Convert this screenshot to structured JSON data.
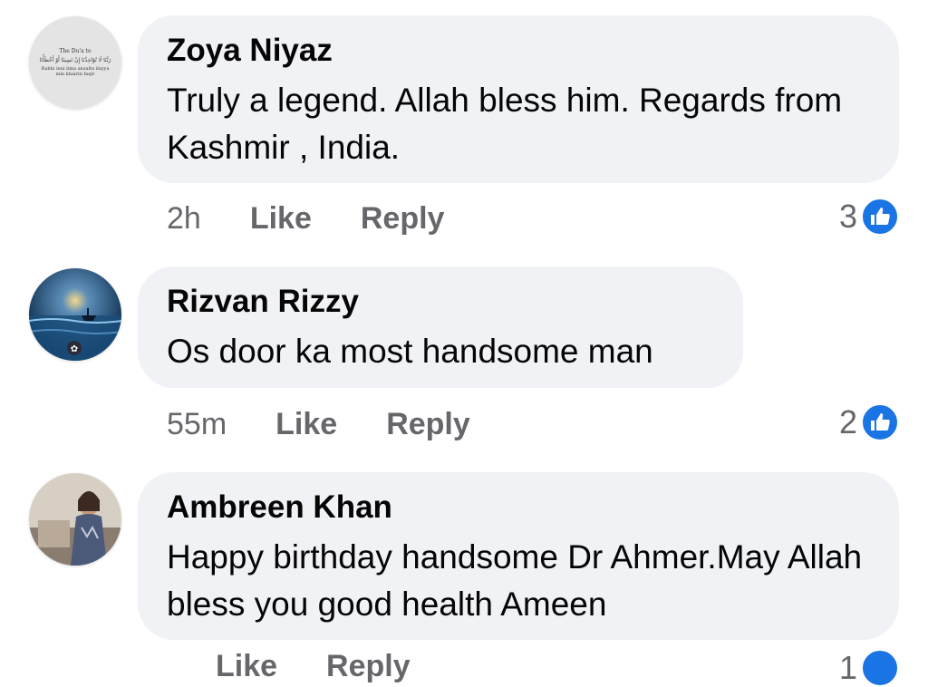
{
  "comments": [
    {
      "author": "Zoya Niyaz",
      "text": "Truly a legend. Allah bless him. Regards from Kashmir , India.",
      "time": "2h",
      "like_label": "Like",
      "reply_label": "Reply",
      "reaction_count": "3",
      "reaction_icon": "thumbs-up-icon",
      "avatar_text": {
        "title": "The Du'a to",
        "arabic": "رَبَّنَا لَا تُؤَاخِذْنَا إِنْ نَسِينَا أَوْ أَخْطَأْنَا",
        "line1": "Rabbi inni lima anzalta ilayya",
        "line2": "min khairin faqir"
      }
    },
    {
      "author": "Rizvan Rizzy",
      "text": "Os door ka most handsome man",
      "time": "55m",
      "like_label": "Like",
      "reply_label": "Reply",
      "reaction_count": "2",
      "reaction_icon": "thumbs-up-icon"
    },
    {
      "author": "Ambreen Khan",
      "text": "Happy birthday handsome Dr Ahmer.May Allah bless you good health Ameen",
      "time": "",
      "like_label": "Like",
      "reply_label": "Reply",
      "reaction_count": "1",
      "reaction_icon": "thumbs-up-icon"
    }
  ],
  "colors": {
    "bubble": "#f0f2f5",
    "meta_text": "#65676b",
    "like_blue": "#1b74e4"
  }
}
